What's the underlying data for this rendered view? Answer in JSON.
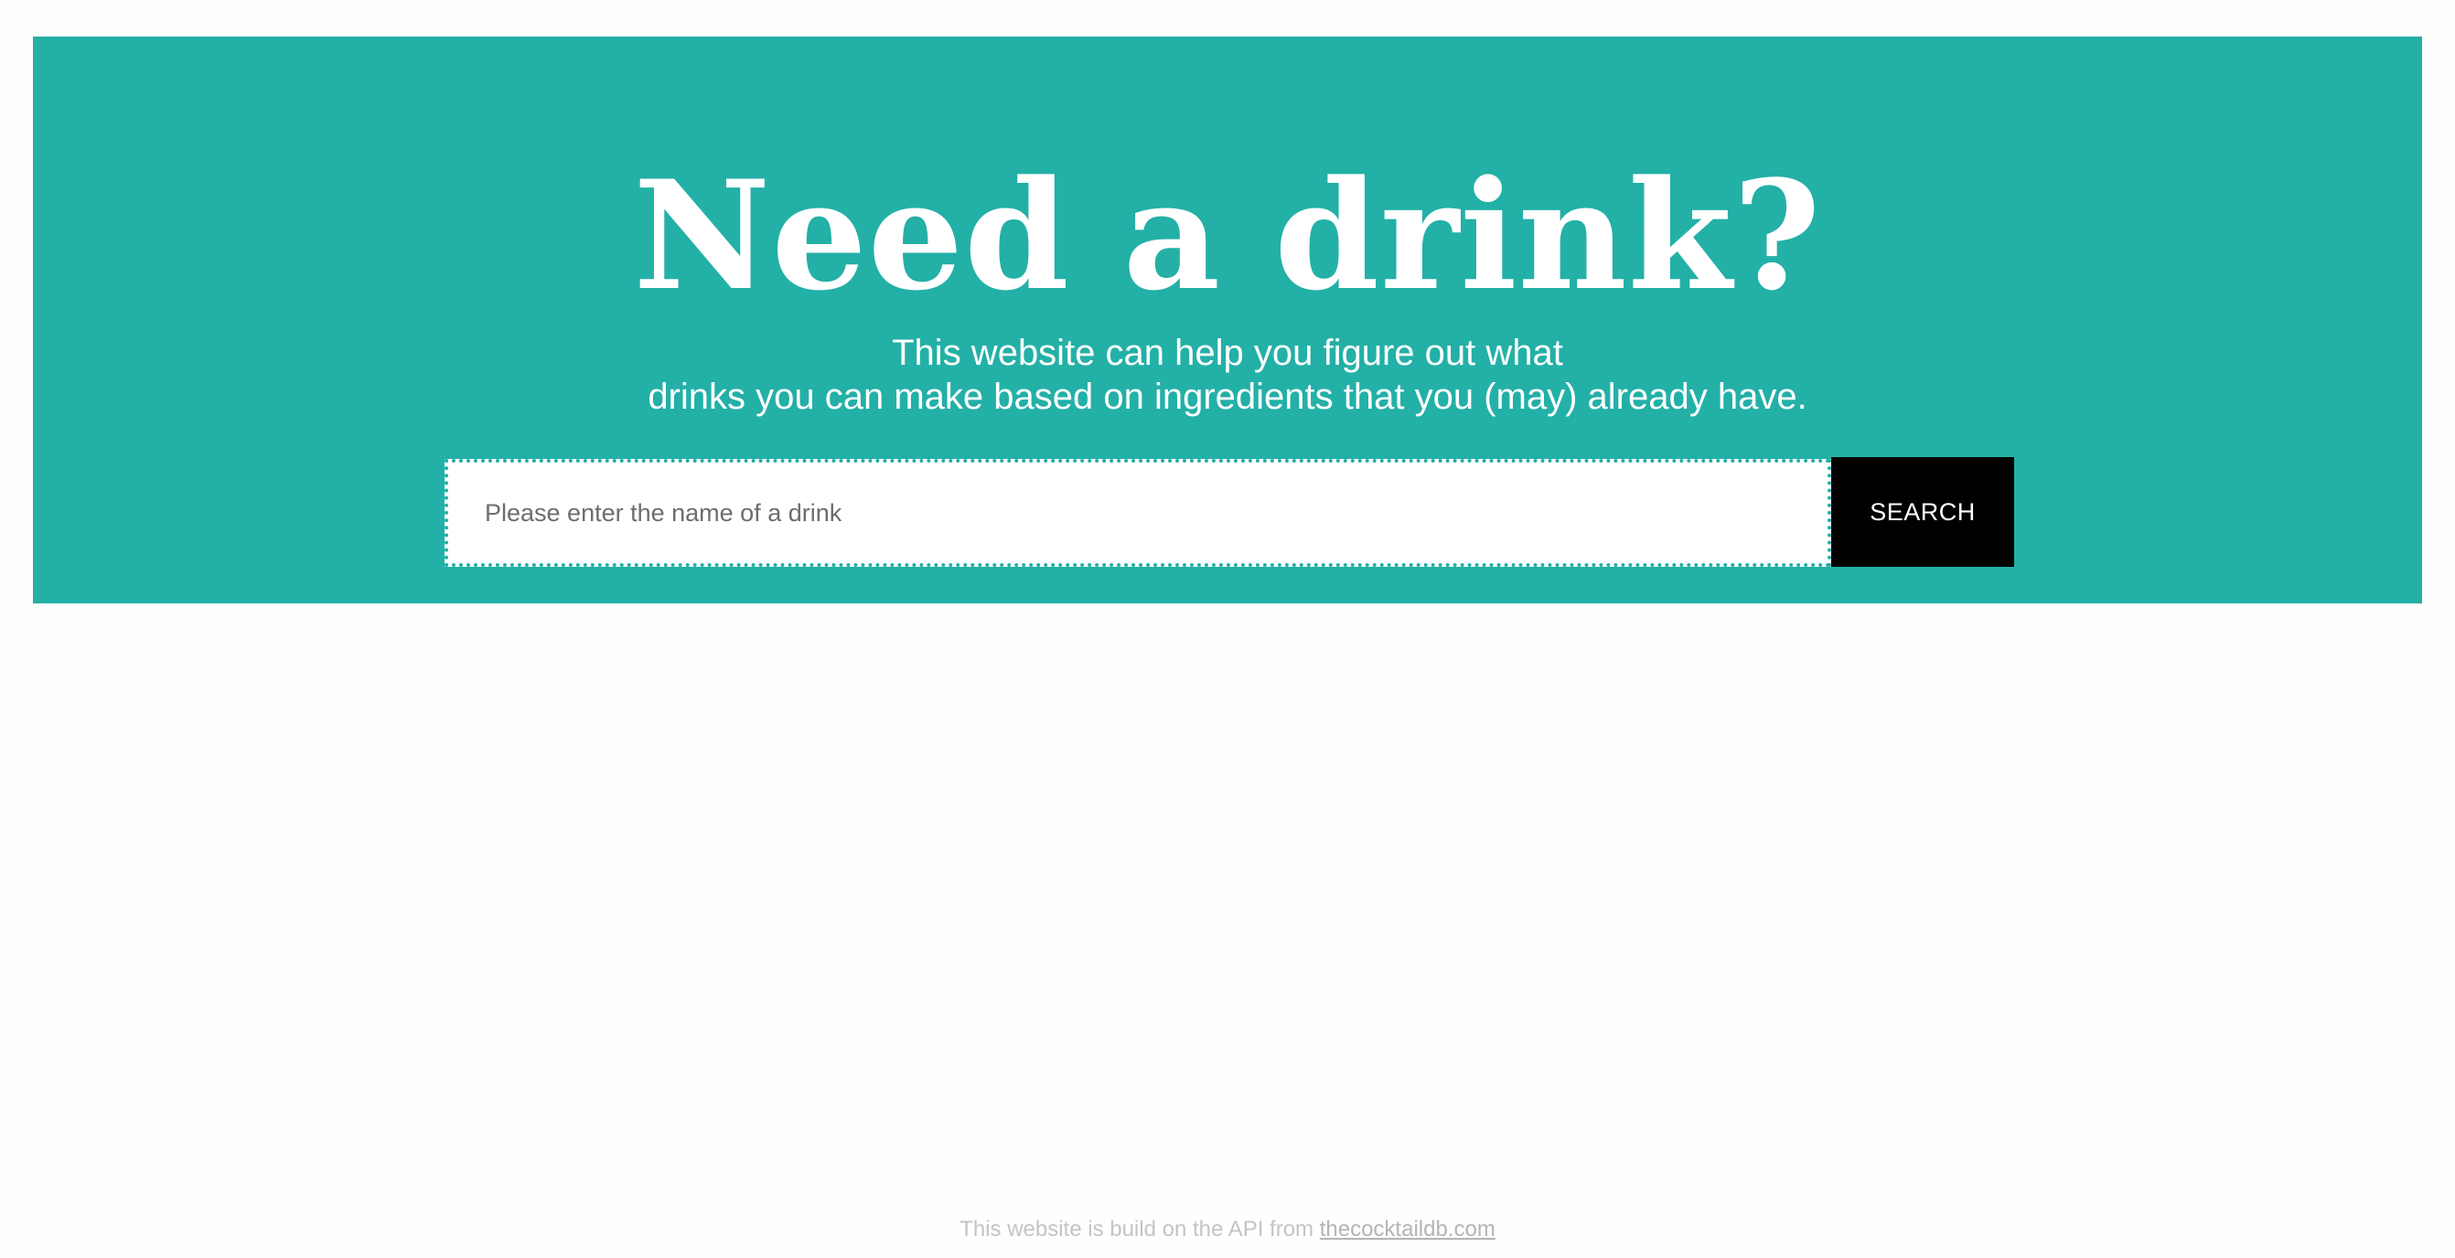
{
  "hero": {
    "title": "Need a drink?",
    "subtitle_line1": "This website can help you figure out what",
    "subtitle_line2": "drinks you can make based on ingredients that you (may) already have.",
    "background_color": "#23b0a7"
  },
  "search": {
    "input_value": "",
    "placeholder": "Please enter the name of a drink",
    "button_label": "SEARCH"
  },
  "footer": {
    "text": "This website is build on the API from",
    "link_text": "thecocktaildb.com"
  }
}
